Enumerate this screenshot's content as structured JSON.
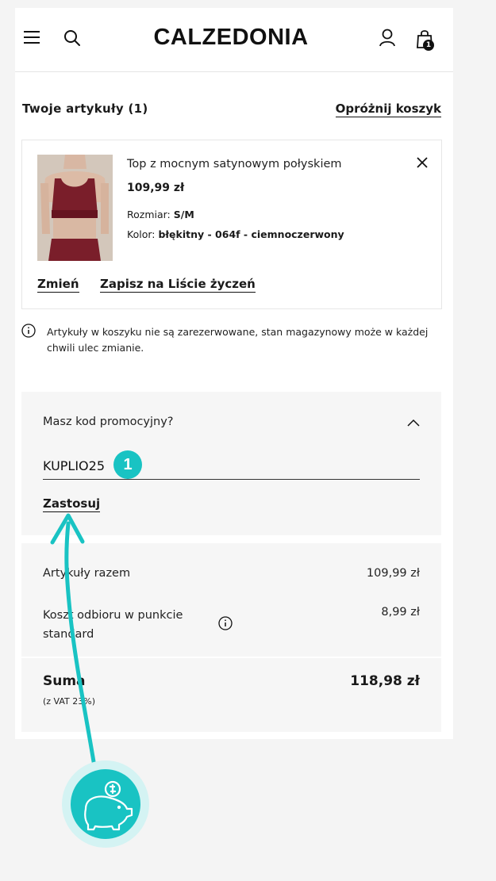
{
  "header": {
    "logo": "CALZEDONIA",
    "bag_count": "1"
  },
  "cart": {
    "title": "Twoje artykuły (1)",
    "empty_label": "Opróżnij koszyk"
  },
  "product": {
    "name": "Top z mocnym satynowym połyskiem",
    "price": "109,99 zł",
    "size_label": "Rozmiar:",
    "size_value": "S/M",
    "color_label": "Kolor:",
    "color_value": "błękitny - 064f - ciemnoczerwony",
    "change_label": "Zmień",
    "wishlist_label": "Zapisz na Liście życzeń"
  },
  "notice": "Artykuły w koszyku nie są zarezerwowane, stan magazynowy może w każdej chwili ulec zmianie.",
  "promo": {
    "question": "Masz kod promocyjny?",
    "code_value": "KUPLIO25",
    "apply_label": "Zastosuj"
  },
  "summary": {
    "items_label": "Artykuły razem",
    "items_value": "109,99 zł",
    "shipping_label": "Koszt odbioru w punkcie standard",
    "shipping_value": "8,99 zł",
    "total_label": "Suma",
    "total_value": "118,98 zł",
    "vat_note": "(z VAT 23%)"
  },
  "annotation": {
    "step_number": "1",
    "accent_color": "#19c3c3",
    "icon": "piggy-bank-coin-icon"
  }
}
